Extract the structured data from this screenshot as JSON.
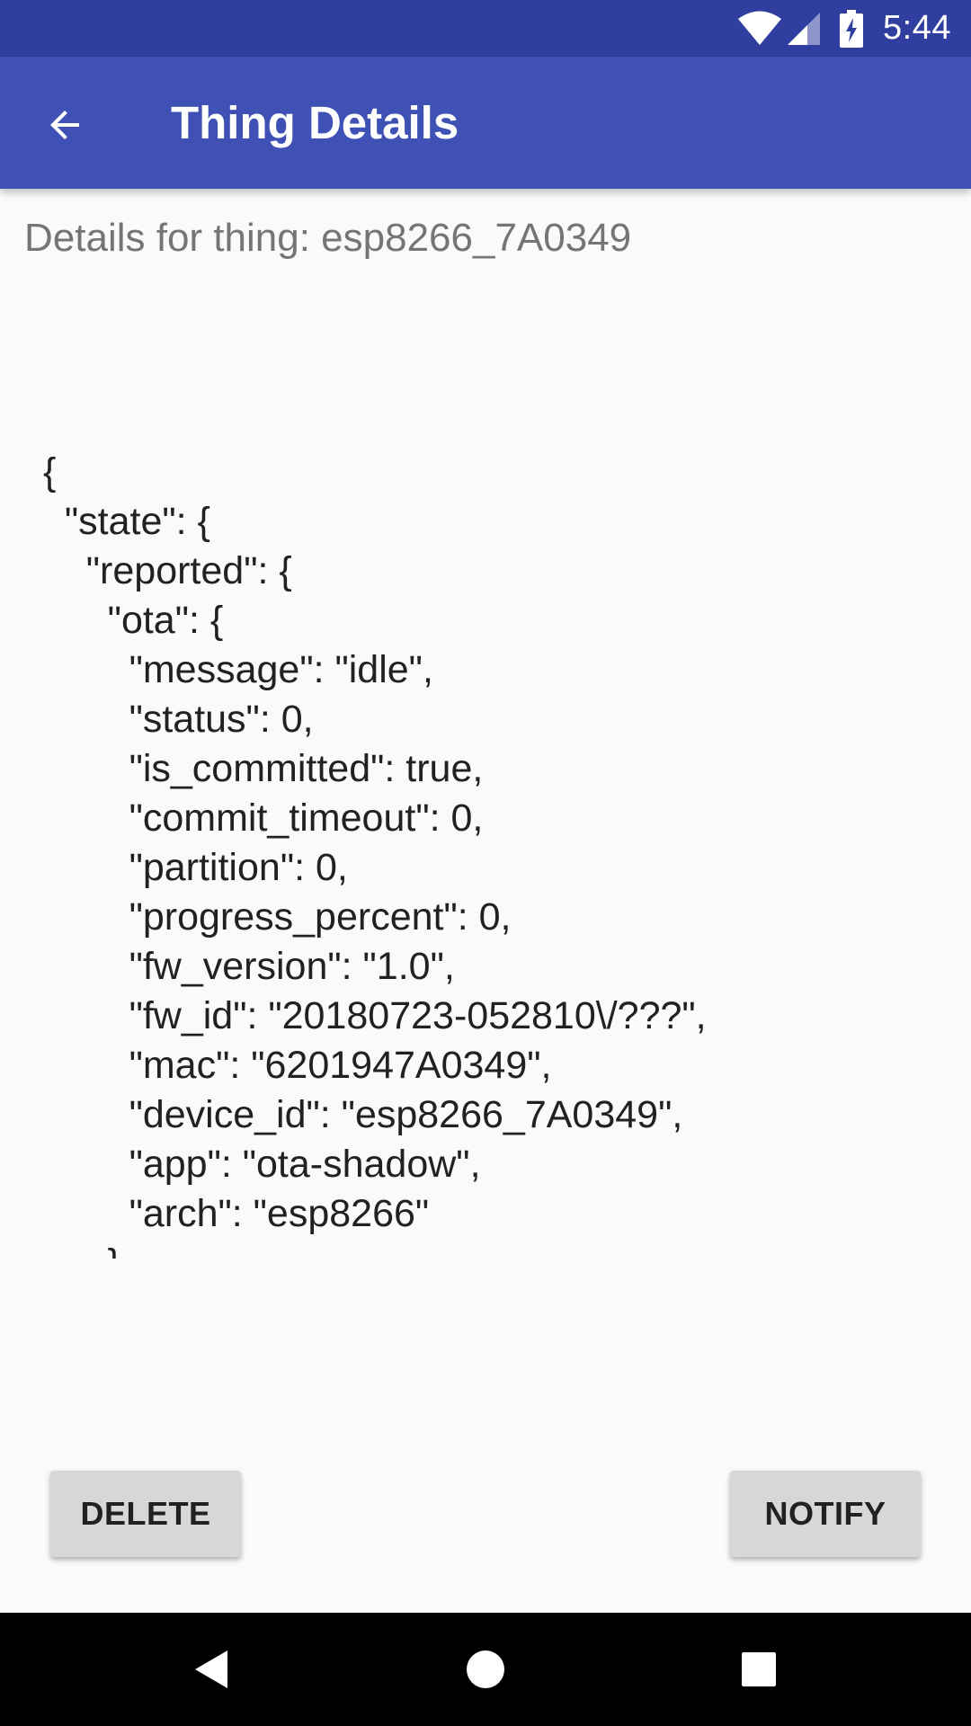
{
  "status_bar": {
    "time": "5:44",
    "icons": [
      "wifi-icon",
      "cell-signal-icon",
      "battery-charging-icon"
    ]
  },
  "app_bar": {
    "title": "Thing Details",
    "back_icon": "arrow-back-icon"
  },
  "details_label": "Details for thing: esp8266_7A0349",
  "json_lines": [
    "{",
    "  \"state\": {",
    "    \"reported\": {",
    "      \"ota\": {",
    "        \"message\": \"idle\",",
    "        \"status\": 0,",
    "        \"is_committed\": true,",
    "        \"commit_timeout\": 0,",
    "        \"partition\": 0,",
    "        \"progress_percent\": 0,",
    "        \"fw_version\": \"1.0\",",
    "        \"fw_id\": \"20180723-052810\\/???\",",
    "        \"mac\": \"6201947A0349\",",
    "        \"device_id\": \"esp8266_7A0349\",",
    "        \"app\": \"ota-shadow\",",
    "        \"arch\": \"esp8266\"",
    "      }"
  ],
  "buttons": {
    "delete_label": "DELETE",
    "notify_label": "NOTIFY"
  },
  "nav_bar": {
    "icons": [
      "nav-back-icon",
      "nav-home-icon",
      "nav-recent-icon"
    ]
  },
  "colors": {
    "status_bar": "#303f9f",
    "app_bar": "#3f51b5",
    "background": "#fafafa",
    "button": "#d6d7d7"
  }
}
